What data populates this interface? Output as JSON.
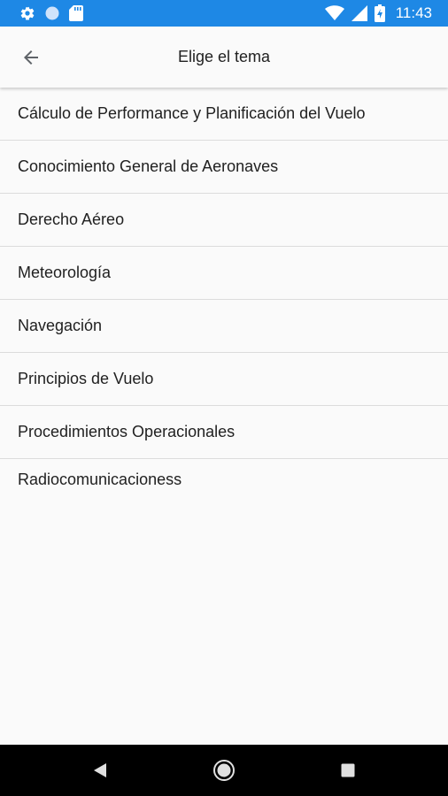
{
  "status_bar": {
    "time": "11:43",
    "color": "#1e88e5",
    "left_icons": [
      "gear-icon",
      "circle-icon",
      "sd-card-icon"
    ],
    "right_icons": [
      "wifi-icon",
      "signal-icon",
      "battery-icon"
    ]
  },
  "app_bar": {
    "title": "Elige el tema",
    "back_icon": "arrow-back-icon"
  },
  "topics": [
    "Cálculo de Performance y Planificación del Vuelo",
    "Conocimiento General de Aeronaves",
    "Derecho Aéreo",
    "Meteorología",
    "Navegación",
    "Principios de Vuelo",
    "Procedimientos Operacionales",
    "Radiocomunicacioness"
  ],
  "nav_bar": {
    "buttons": [
      "back-triangle-icon",
      "home-circle-icon",
      "recents-square-icon"
    ]
  }
}
